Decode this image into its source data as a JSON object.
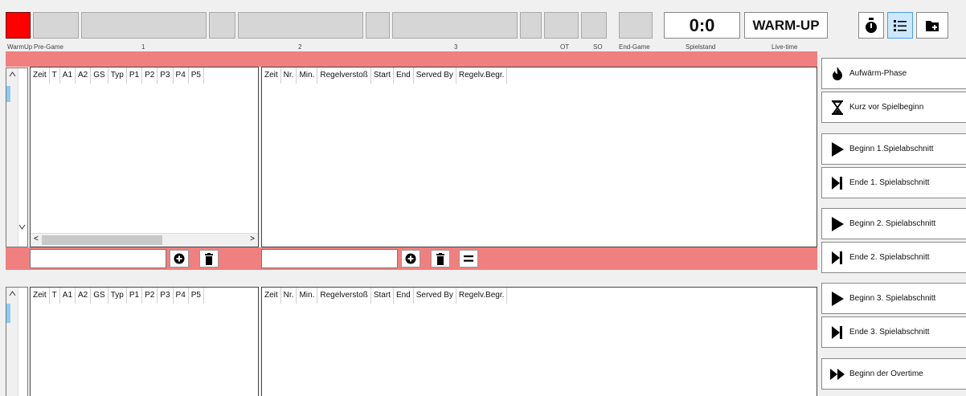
{
  "phases": {
    "warmup": "WarmUp",
    "pregame": "Pre-Game",
    "p1": "1",
    "p2": "2",
    "p3": "3",
    "ot": "OT",
    "so": "SO",
    "endgame": "End-Game",
    "spielstand": "Spielstand",
    "livetime": "Live-time"
  },
  "score": "0:0",
  "live_state": "WARM-UP",
  "toolbar_icons": [
    "stopwatch-icon",
    "list-icon",
    "folder-plus-icon"
  ],
  "penalty_table": {
    "columns": [
      "Zeit",
      "T",
      "A1",
      "A2",
      "GS",
      "Typ",
      "P1",
      "P2",
      "P3",
      "P4",
      "P5"
    ]
  },
  "rule_table": {
    "columns": [
      "Zeit",
      "Nr.",
      "Min.",
      "Regelverstoß",
      "Start",
      "End",
      "Served By",
      "Regelv.Begr."
    ]
  },
  "side_buttons": [
    {
      "label": "Aufwärm-Phase",
      "icon": "fire-icon"
    },
    {
      "label": "Kurz vor Spielbeginn",
      "icon": "hourglass-icon"
    },
    {
      "label": "Beginn 1.Spielabschnitt",
      "icon": "play-icon"
    },
    {
      "label": "Ende 1. Spielabschnitt",
      "icon": "step-end-icon"
    },
    {
      "label": "Beginn 2. Spielabschnitt",
      "icon": "play-icon"
    },
    {
      "label": "Ende 2. Spielabschnitt",
      "icon": "step-end-icon"
    },
    {
      "label": "Beginn 3. Spielabschnitt",
      "icon": "play-icon"
    },
    {
      "label": "Ende 3. Spielabschnitt",
      "icon": "step-end-icon"
    },
    {
      "label": "Beginn der Overtime",
      "icon": "fast-forward-icon"
    }
  ],
  "colors": {
    "active_phase": "#ff0000",
    "band": "#f08080",
    "selected_tool": "#cce8ff"
  }
}
